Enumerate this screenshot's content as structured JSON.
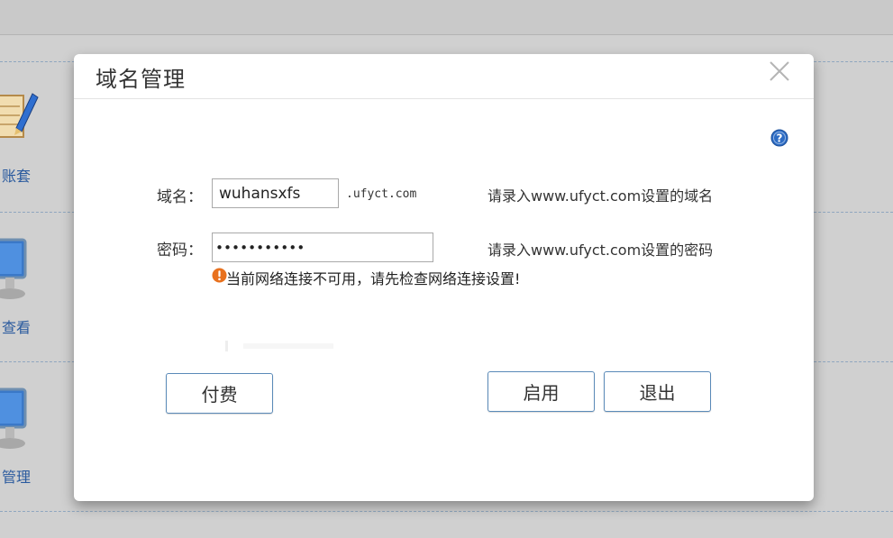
{
  "background": {
    "items": [
      {
        "label": "账套"
      },
      {
        "label": "查看"
      },
      {
        "label": "管理"
      }
    ]
  },
  "dialog": {
    "title": "域名管理",
    "domain": {
      "label": "域名：",
      "value": "wuhansxfs",
      "suffix": ".ufyct.com",
      "hint": "请录入www.ufyct.com设置的域名"
    },
    "password": {
      "label": "密码：",
      "masked_value": "•••••••••••",
      "hint": "请录入www.ufyct.com设置的密码"
    },
    "error": {
      "message": "当前网络连接不可用，请先检查网络连接设置!"
    },
    "buttons": {
      "pay": "付费",
      "enable": "启用",
      "exit": "退出"
    }
  },
  "colors": {
    "accent_blue": "#2a5a9e",
    "button_border": "#5a8ab8",
    "error_orange": "#e8711e",
    "help_blue": "#2d6cc4"
  }
}
